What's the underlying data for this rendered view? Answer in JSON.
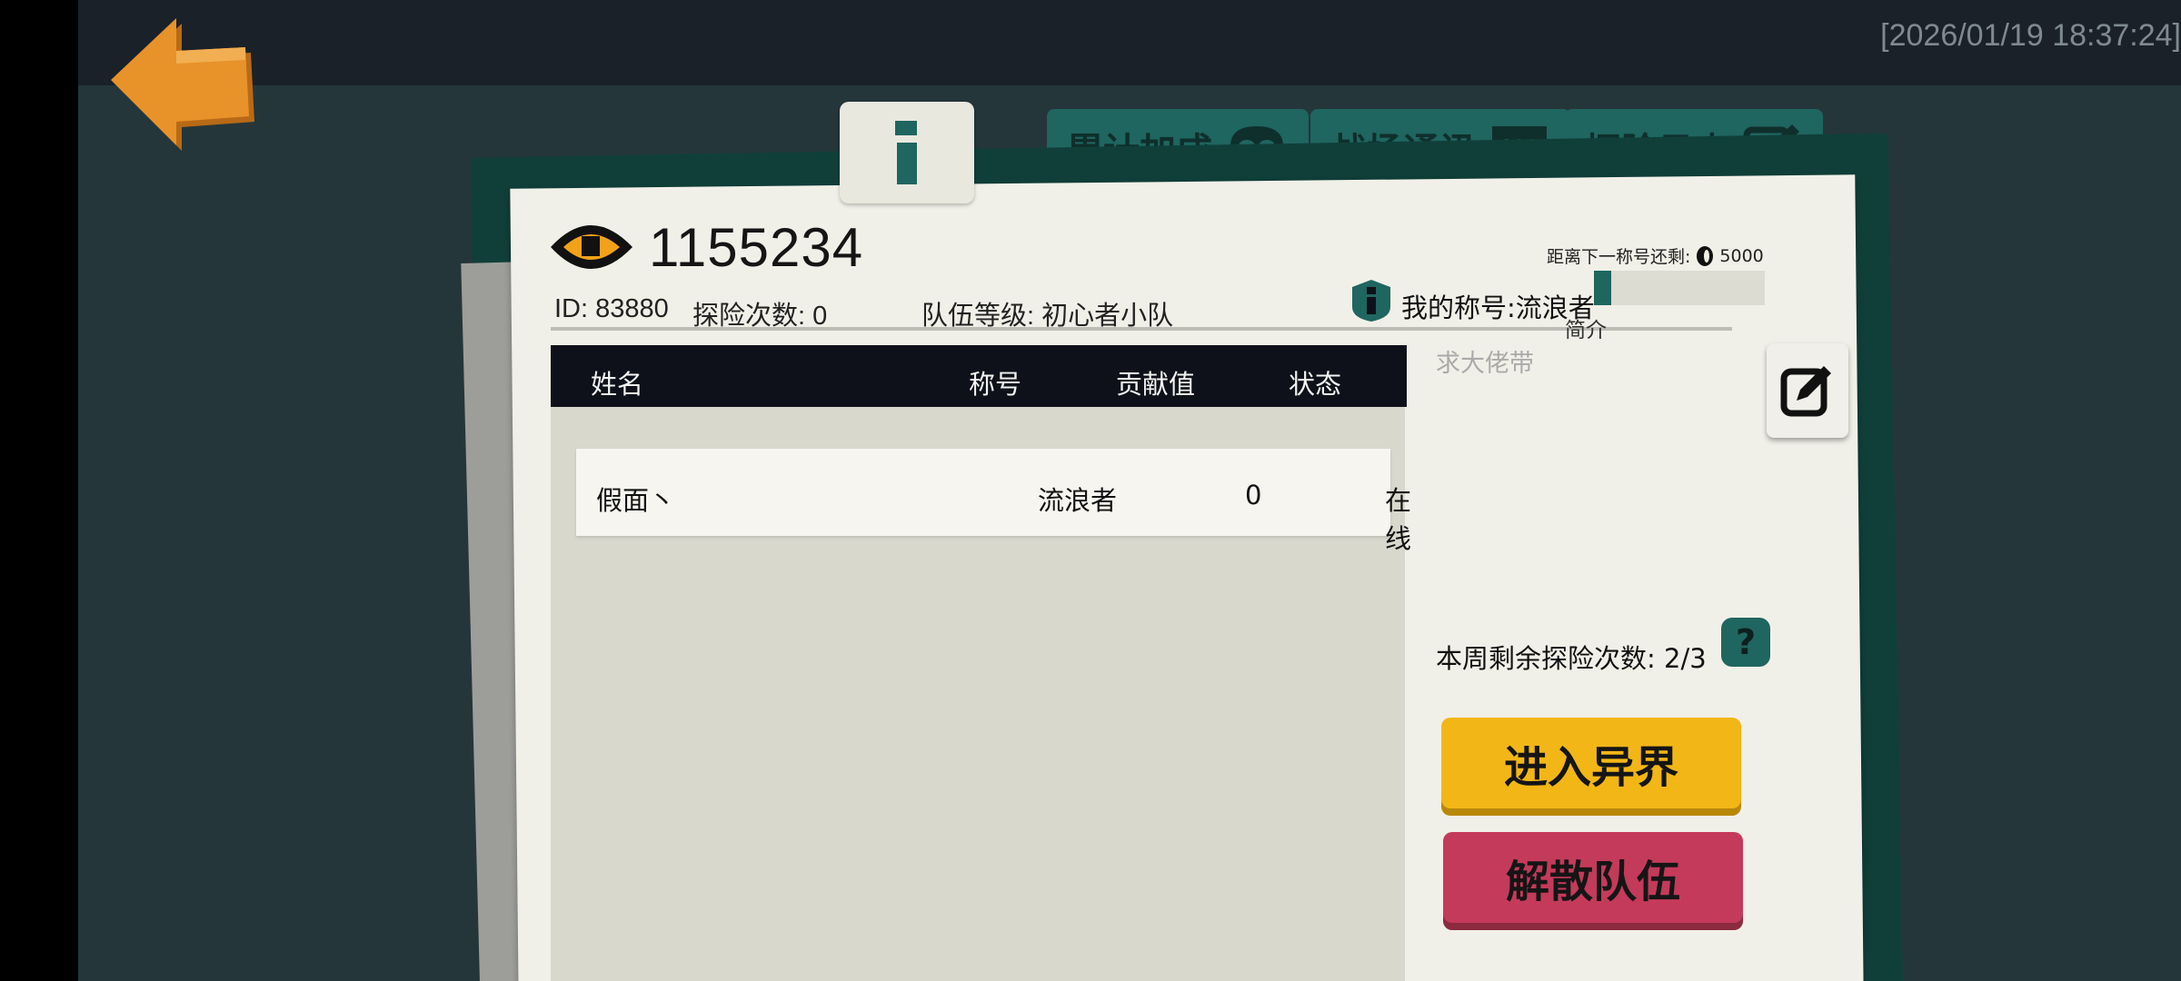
{
  "status_bar": {
    "timestamp": "[2026/01/19 18:37:24]"
  },
  "tabs": [
    {
      "label": "累计加成",
      "icon": "skull-icon"
    },
    {
      "label": "战场通讯",
      "icon": "chat-icon"
    },
    {
      "label": "探险日志",
      "icon": "edit-icon"
    }
  ],
  "team": {
    "name": "1155234",
    "id_label": "ID: 83880",
    "explore_count_label": "探险次数: 0",
    "level_label": "队伍等级: 初心者小队"
  },
  "title_progress": {
    "label": "距离下一称号还剩:",
    "coin_icon": "coin-icon",
    "remaining": "5000",
    "fill_fraction": 0.1
  },
  "my_title": "我的称号:流浪者",
  "intro": {
    "label": "简介",
    "text": "求大佬带"
  },
  "table": {
    "headers": [
      "姓名",
      "称号",
      "贡献值",
      "状态"
    ],
    "rows": [
      {
        "name": "假面丶",
        "title": "流浪者",
        "contribution": "0",
        "status": "在线"
      }
    ]
  },
  "weekly_remaining": "本周剩余探险次数: 2/3",
  "help_icon_text": "?",
  "buttons": {
    "enter": "进入异界",
    "disband": "解散队伍"
  },
  "colors": {
    "background": "#25363a",
    "accent_teal": "#1f6560",
    "enter_yellow": "#f2b616",
    "disband_pink": "#c43a5a",
    "back_orange": "#e8922a"
  }
}
